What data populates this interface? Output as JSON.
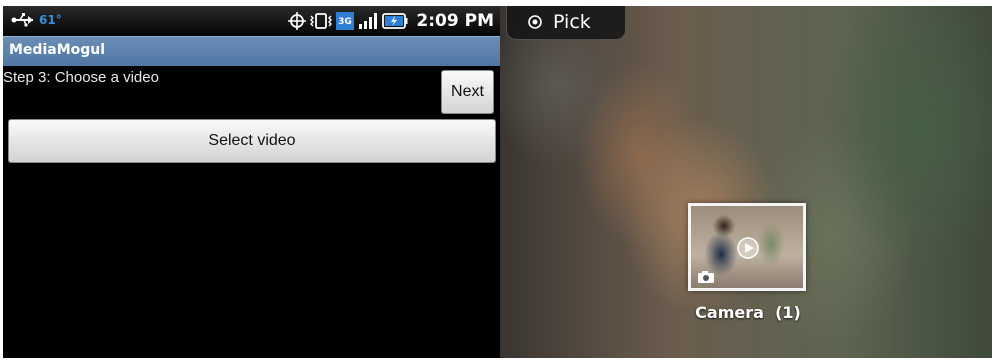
{
  "left_screen": {
    "status_bar": {
      "temperature": "61°",
      "time": "2:09 PM",
      "network": "3G",
      "icons": [
        "usb-icon",
        "gps-icon",
        "vibrate-icon",
        "3g-icon",
        "signal-icon",
        "battery-icon"
      ]
    },
    "app_title": "MediaMogul",
    "step_label": "Step 3: Choose a video",
    "next_label": "Next",
    "select_video_label": "Select video"
  },
  "right_screen": {
    "pick_label": "Pick",
    "album": {
      "name": "Camera",
      "count": "(1)",
      "caption": "Camera  (1)"
    }
  },
  "colors": {
    "titlebar": "#5a7fac",
    "background": "#000000",
    "temperature": "#3b8fd6"
  }
}
